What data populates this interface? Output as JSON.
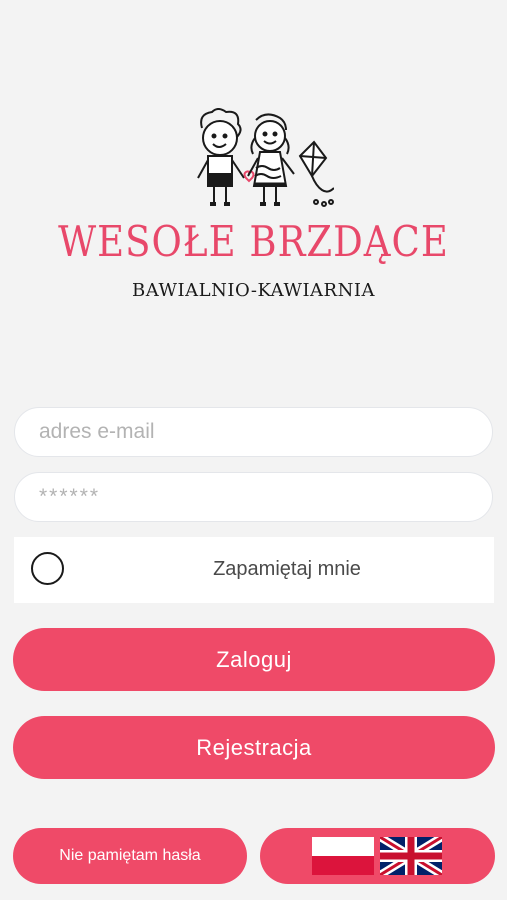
{
  "brand": {
    "title": "WESOŁE BRZDĄCE",
    "subtitle": "BAWIALNIO-KAWIARNIA"
  },
  "login": {
    "email_placeholder": "adres e-mail",
    "password_placeholder": "******",
    "remember_label": "Zapamiętaj mnie",
    "login_button": "Zaloguj",
    "register_button": "Rejestracja",
    "forgot_button": "Nie pamiętam hasła"
  },
  "languages": [
    "polish-flag-icon",
    "british-flag-icon"
  ],
  "colors": {
    "accent": "#ef4a68",
    "background": "#f3f3f3"
  }
}
